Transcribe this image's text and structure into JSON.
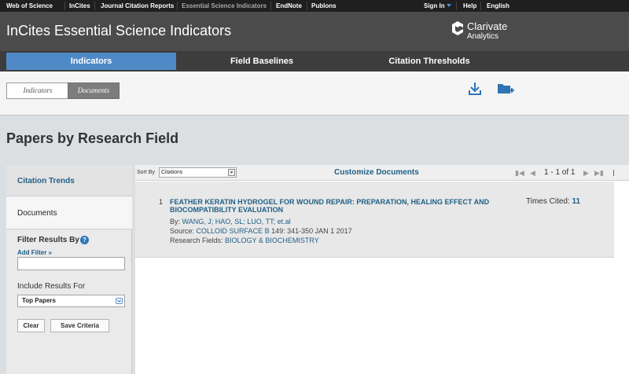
{
  "topbar": {
    "links": [
      "Web of Science",
      "InCites",
      "Journal Citation Reports",
      "Essential Science Indicators",
      "EndNote",
      "Publons"
    ],
    "sign_in": "Sign In",
    "help": "Help",
    "language": "English"
  },
  "header": {
    "title": "InCites Essential Science Indicators",
    "logo_name": "Clarivate",
    "logo_sub": "Analytics"
  },
  "tabs": [
    "Indicators",
    "Field Baselines",
    "Citation Thresholds"
  ],
  "breadcrumb": [
    "Indicators",
    "Documents"
  ],
  "page_title": "Papers by Research Field",
  "sidebar": {
    "citation_trends": "Citation Trends",
    "documents": "Documents",
    "filter_results_by": "Filter Results By",
    "add_filter": "Add Filter »",
    "include_results_for": "Include Results For",
    "include_value": "Top Papers",
    "clear_label": "Clear",
    "save_criteria_label": "Save Criteria"
  },
  "toolbar": {
    "sort_by_label": "Sort By",
    "sort_value": "Citations",
    "customize": "Customize Documents",
    "page_count": "1 - 1 of 1"
  },
  "documents": [
    {
      "number": "1",
      "title": "FEATHER KERATIN HYDROGEL FOR WOUND REPAIR: PREPARATION, HEALING EFFECT AND BIOCOMPATIBILITY EVALUATION",
      "times_cited_label": "Times Cited:",
      "times_cited": "11",
      "by_label": "By:",
      "authors": [
        "WANG, J;",
        "HAO, SL;",
        "LUO, TT;",
        "et.al"
      ],
      "source_label": "Source:",
      "source_journal": "COLLOID SURFACE B",
      "source_rest": "149: 341-350 JAN 1 2017",
      "fields_label": "Research Fields:",
      "fields_value": "BIOLOGY & BIOCHEMISTRY"
    }
  ],
  "colors": {
    "accent": "#4f8ac7",
    "link": "#1f5f86",
    "header_bg": "#4b4b4b"
  }
}
